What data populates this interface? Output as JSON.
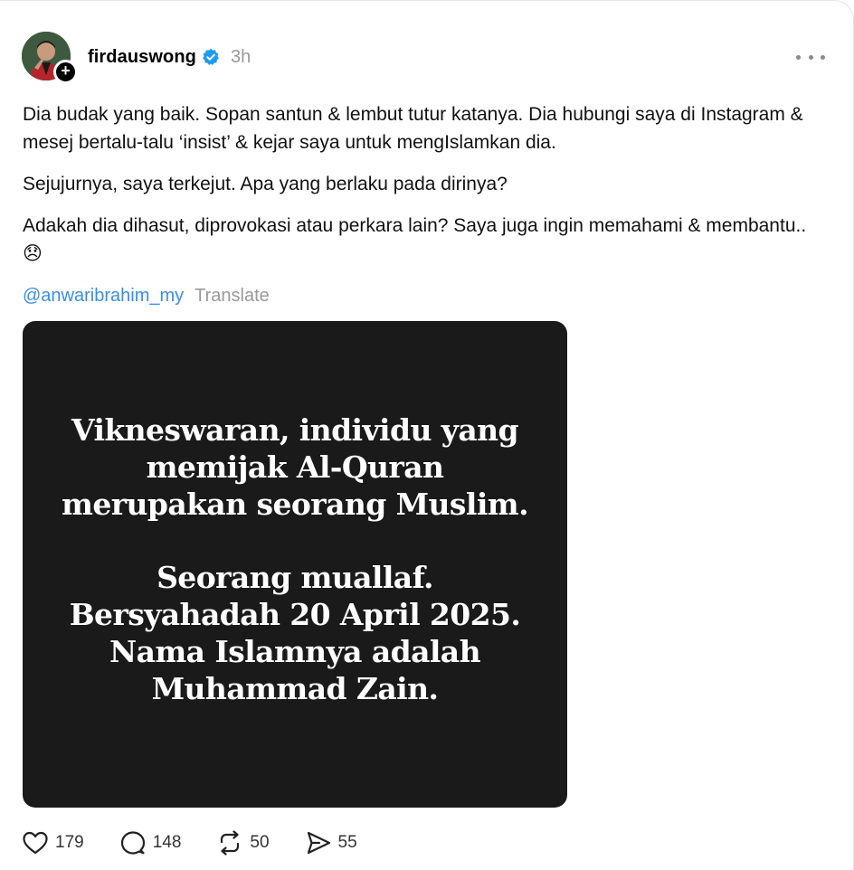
{
  "post": {
    "username": "firdauswong",
    "timestamp": "3h",
    "paragraphs": [
      "Dia budak yang baik. Sopan santun & lembut tutur katanya. Dia hubungi saya di Instagram & mesej bertalu-talu ‘insist’ & kejar saya untuk mengIslamkan dia.",
      "Sejujurnya, saya terkejut. Apa yang berlaku pada dirinya?",
      "Adakah dia dihasut, diprovokasi atau perkara lain? Saya juga ingin memahami & membantu..😞"
    ],
    "mention": "@anwaribrahim_my",
    "translate_label": "Translate",
    "image_text": {
      "block1": [
        "Vikneswaran, individu yang",
        "memijak Al-Quran",
        "merupakan seorang Muslim."
      ],
      "block2": [
        "Seorang muallaf.",
        "Bersyahadah 20 April 2025.",
        "Nama Islamnya adalah",
        "Muhammad Zain."
      ]
    }
  },
  "actions": {
    "likes": "179",
    "replies": "148",
    "reposts": "50",
    "shares": "55"
  },
  "icons": {
    "verified": "verified-badge-icon",
    "more": "more-options-icon",
    "like": "heart-icon",
    "reply": "speech-bubble-icon",
    "repost": "repost-icon",
    "share": "send-icon"
  },
  "colors": {
    "mention": "#3a8ee6",
    "verified": "#1d9bf0",
    "muted": "#999999",
    "media_bg": "#1b1a1a"
  }
}
